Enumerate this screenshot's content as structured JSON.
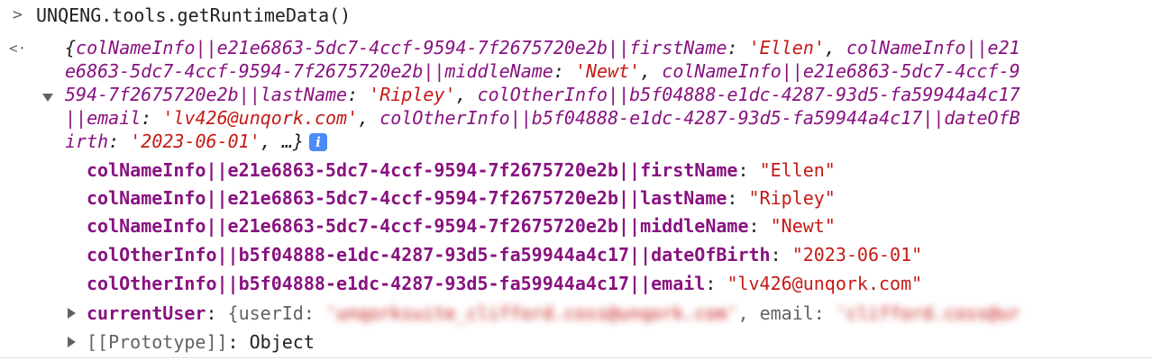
{
  "console": {
    "input_prompt": ">",
    "command": "UNQENG.tools.getRuntimeData()",
    "result_marker": "<·",
    "preview_lines": [
      "{colNameInfo||e21e6863-5dc7-4ccf-9594-7f2675720e2b||firstName: 'Ellen', colNameInfo||e21",
      "e6863-5dc7-4ccf-9594-7f2675720e2b||middleName: 'Newt', colNameInfo||e21e6863-5dc7-4ccf-9",
      "594-7f2675720e2b||lastName: 'Ripley', colOtherInfo||b5f04888-e1dc-4287-93d5-fa59944a4c17",
      "||email: 'lv426@unqork.com', colOtherInfo||b5f04888-e1dc-4287-93d5-fa59944a4c17||dateOfB",
      "irth: '2023-06-01', …}"
    ],
    "info_badge": "i",
    "properties": [
      {
        "key": "colNameInfo||e21e6863-5dc7-4ccf-9594-7f2675720e2b||firstName",
        "value": "\"Ellen\""
      },
      {
        "key": "colNameInfo||e21e6863-5dc7-4ccf-9594-7f2675720e2b||lastName",
        "value": "\"Ripley\""
      },
      {
        "key": "colNameInfo||e21e6863-5dc7-4ccf-9594-7f2675720e2b||middleName",
        "value": "\"Newt\""
      },
      {
        "key": "colOtherInfo||b5f04888-e1dc-4287-93d5-fa59944a4c17||dateOfBirth",
        "value": "\"2023-06-01\""
      },
      {
        "key": "colOtherInfo||b5f04888-e1dc-4287-93d5-fa59944a4c17||email",
        "value": "\"lv426@unqork.com\""
      }
    ],
    "current_user": {
      "key": "currentUser",
      "open": "{userId:",
      "blurred_user_id": "'unqorksuite_clifford.coss@unqork.com'",
      "email_label": ", email:",
      "blurred_email": "'clifford.coss@ur"
    },
    "prototype": {
      "key": "[[Prototype]]",
      "value": "Object"
    }
  }
}
